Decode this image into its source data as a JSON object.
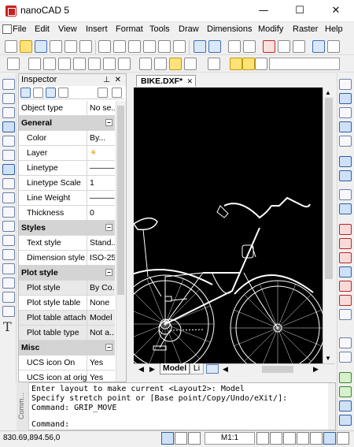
{
  "window": {
    "title": "nanoCAD 5",
    "minimize": "—",
    "maximize": "☐",
    "close": "✕"
  },
  "menu": [
    "File",
    "Edit",
    "View",
    "Insert",
    "Format",
    "Tools",
    "Draw",
    "Dimensions",
    "Modify",
    "Raster",
    "Help"
  ],
  "inspector": {
    "title": "Inspector",
    "rows": [
      {
        "label": "Object type",
        "value": "No se...",
        "type": "prop"
      },
      {
        "label": "General",
        "type": "section"
      },
      {
        "label": "Color",
        "value": "By...",
        "type": "prop",
        "indent": true
      },
      {
        "label": "Layer",
        "value": "",
        "type": "prop",
        "indent": true
      },
      {
        "label": "Linetype",
        "value": "———",
        "type": "prop",
        "indent": true
      },
      {
        "label": "Linetype Scale",
        "value": "1",
        "type": "prop",
        "indent": true
      },
      {
        "label": "Line Weight",
        "value": "———",
        "type": "prop",
        "indent": true
      },
      {
        "label": "Thickness",
        "value": "0",
        "type": "prop",
        "indent": true
      },
      {
        "label": "Styles",
        "type": "section"
      },
      {
        "label": "Text style",
        "value": "Stand...",
        "type": "prop",
        "indent": true
      },
      {
        "label": "Dimension style",
        "value": "ISO-25",
        "type": "prop",
        "indent": true
      },
      {
        "label": "Plot style",
        "type": "section"
      },
      {
        "label": "Plot style",
        "value": "By Co...",
        "type": "prop",
        "indent": true,
        "shade": true
      },
      {
        "label": "Plot style table",
        "value": "None",
        "type": "prop",
        "indent": true
      },
      {
        "label": "Plot table attach...",
        "value": "Model",
        "type": "prop",
        "indent": true,
        "shade": true
      },
      {
        "label": "Plot table type",
        "value": "Not a...",
        "type": "prop",
        "indent": true,
        "shade": true
      },
      {
        "label": "Misc",
        "type": "section"
      },
      {
        "label": "UCS icon On",
        "value": "Yes",
        "type": "prop",
        "indent": true
      },
      {
        "label": "UCS icon at origin",
        "value": "Yes",
        "type": "prop",
        "indent": true
      }
    ]
  },
  "document": {
    "tab": "BIKE.DXF*",
    "tab_close": "✕"
  },
  "layout_tabs": {
    "model": "Model",
    "layout": "Li"
  },
  "command": {
    "lines": [
      "Enter layout to make current <Layout2>: Model",
      "Specify stretch point or [Base point/Copy/Undo/eXit/]:",
      "Command: GRIP_MOVE"
    ],
    "prompt": "Command:",
    "grip_label": "Comm..."
  },
  "status": {
    "coords": "830.69,894.56,0",
    "scale": "M1:1"
  }
}
